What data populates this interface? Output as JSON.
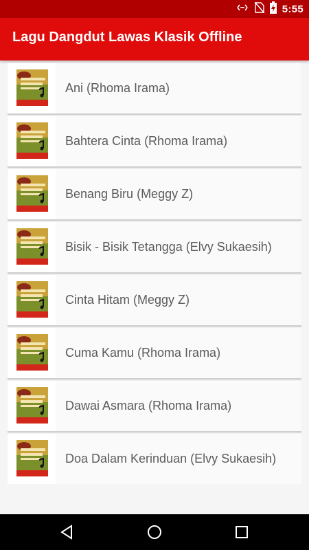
{
  "status_bar": {
    "time": "5:55",
    "icons": [
      "data-transfer-icon",
      "no-sim-icon",
      "battery-charging-icon"
    ]
  },
  "app_bar": {
    "title": "Lagu Dangdut Lawas Klasik Offline"
  },
  "songs": [
    {
      "title": "Ani (Rhoma Irama)"
    },
    {
      "title": "Bahtera Cinta (Rhoma Irama)"
    },
    {
      "title": "Benang Biru (Meggy Z)"
    },
    {
      "title": "Bisik - Bisik Tetangga (Elvy Sukaesih)"
    },
    {
      "title": "Cinta Hitam (Meggy Z)"
    },
    {
      "title": "Cuma Kamu (Rhoma Irama)"
    },
    {
      "title": "Dawai Asmara (Rhoma Irama)"
    },
    {
      "title": "Doa Dalam Kerinduan (Elvy Sukaesih)"
    }
  ],
  "thumbnail": {
    "label": "Dangdut",
    "logo_text": "Lagu Dangdut Lawas Offline"
  },
  "nav_bar": {
    "buttons": [
      "back-icon",
      "home-icon",
      "recents-icon"
    ]
  },
  "colors": {
    "status_bar": "#b00000",
    "app_bar": "#e00b0b",
    "list_bg": "#fafafa",
    "text": "#5b5b5b"
  }
}
